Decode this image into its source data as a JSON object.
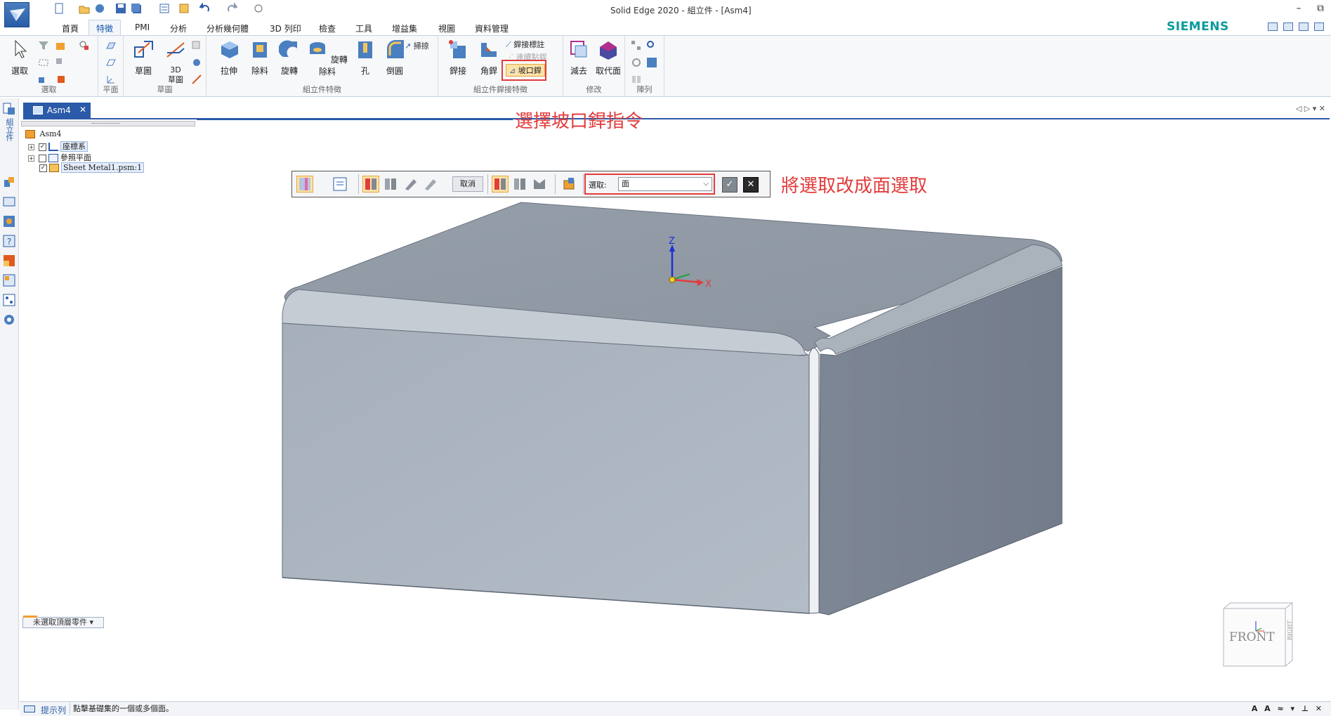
{
  "window": {
    "title": "Solid Edge 2020 - 組立件 - [Asm4]",
    "brand": "SIEMENS",
    "controls": [
      "–",
      "⧉"
    ]
  },
  "ribbon_tabs": [
    "首頁",
    "特徵",
    "PMI",
    "分析",
    "分析幾何體",
    "3D 列印",
    "檢查",
    "工具",
    "增益集",
    "視圖",
    "資料管理"
  ],
  "ribbon": {
    "groups": {
      "select": "選取",
      "plane": "平面",
      "sketch": "草圖",
      "assembly_features": "組立件特徵",
      "weld_features": "組立件銲接特徵",
      "modify": "修改",
      "pattern": "陣列"
    },
    "buttons": {
      "select": "選取",
      "sketch": "草圖",
      "sketch3d": "3D\n草圖",
      "extrude": "拉伸",
      "cutout": "除料",
      "revolve": "旋轉",
      "revolve_cut": "旋轉除料",
      "hole": "孔",
      "chamfer": "倒圓",
      "sweep": "掃掠",
      "weld": "銲接",
      "fillet_weld": "角銲",
      "weld_bead_label": "銲接標註",
      "stitch_weld": "連續點銲",
      "groove_weld": "坡口銲",
      "subtract": "減去",
      "replace_face": "取代面"
    }
  },
  "doc_tab": {
    "label": "Asm4",
    "close": "✕"
  },
  "doc_nav": "◁ ▷ ▾ ✕",
  "tree": {
    "root": "Asm4",
    "items": [
      {
        "label": "座標系",
        "checked": true
      },
      {
        "label": "參照平面",
        "checked": false
      },
      {
        "label": "Sheet Metal1.psm:1",
        "checked": true
      }
    ]
  },
  "left_strip_label": "組立件",
  "unselected_button": "未選取頂層零件 ▾",
  "command_bar": {
    "cancel": "取消",
    "select_label": "選取:",
    "select_value": "面"
  },
  "annotations": {
    "top": "選擇坡口銲指令",
    "right": "將選取改成面選取"
  },
  "triad": {
    "z": "Z",
    "x": "X"
  },
  "viewcube": {
    "front": "FRONT",
    "right": "RIGHT"
  },
  "status": {
    "label": "提示列",
    "prompt": "點擊基礎集的一個或多個面。",
    "right": "A A ≈ ▾ ⊥ ✕"
  },
  "colors": {
    "accent": "#2b5aa8",
    "annotation": "#e23c3c",
    "brand": "#0a9a9a",
    "model_face": "#a9b2bd"
  }
}
